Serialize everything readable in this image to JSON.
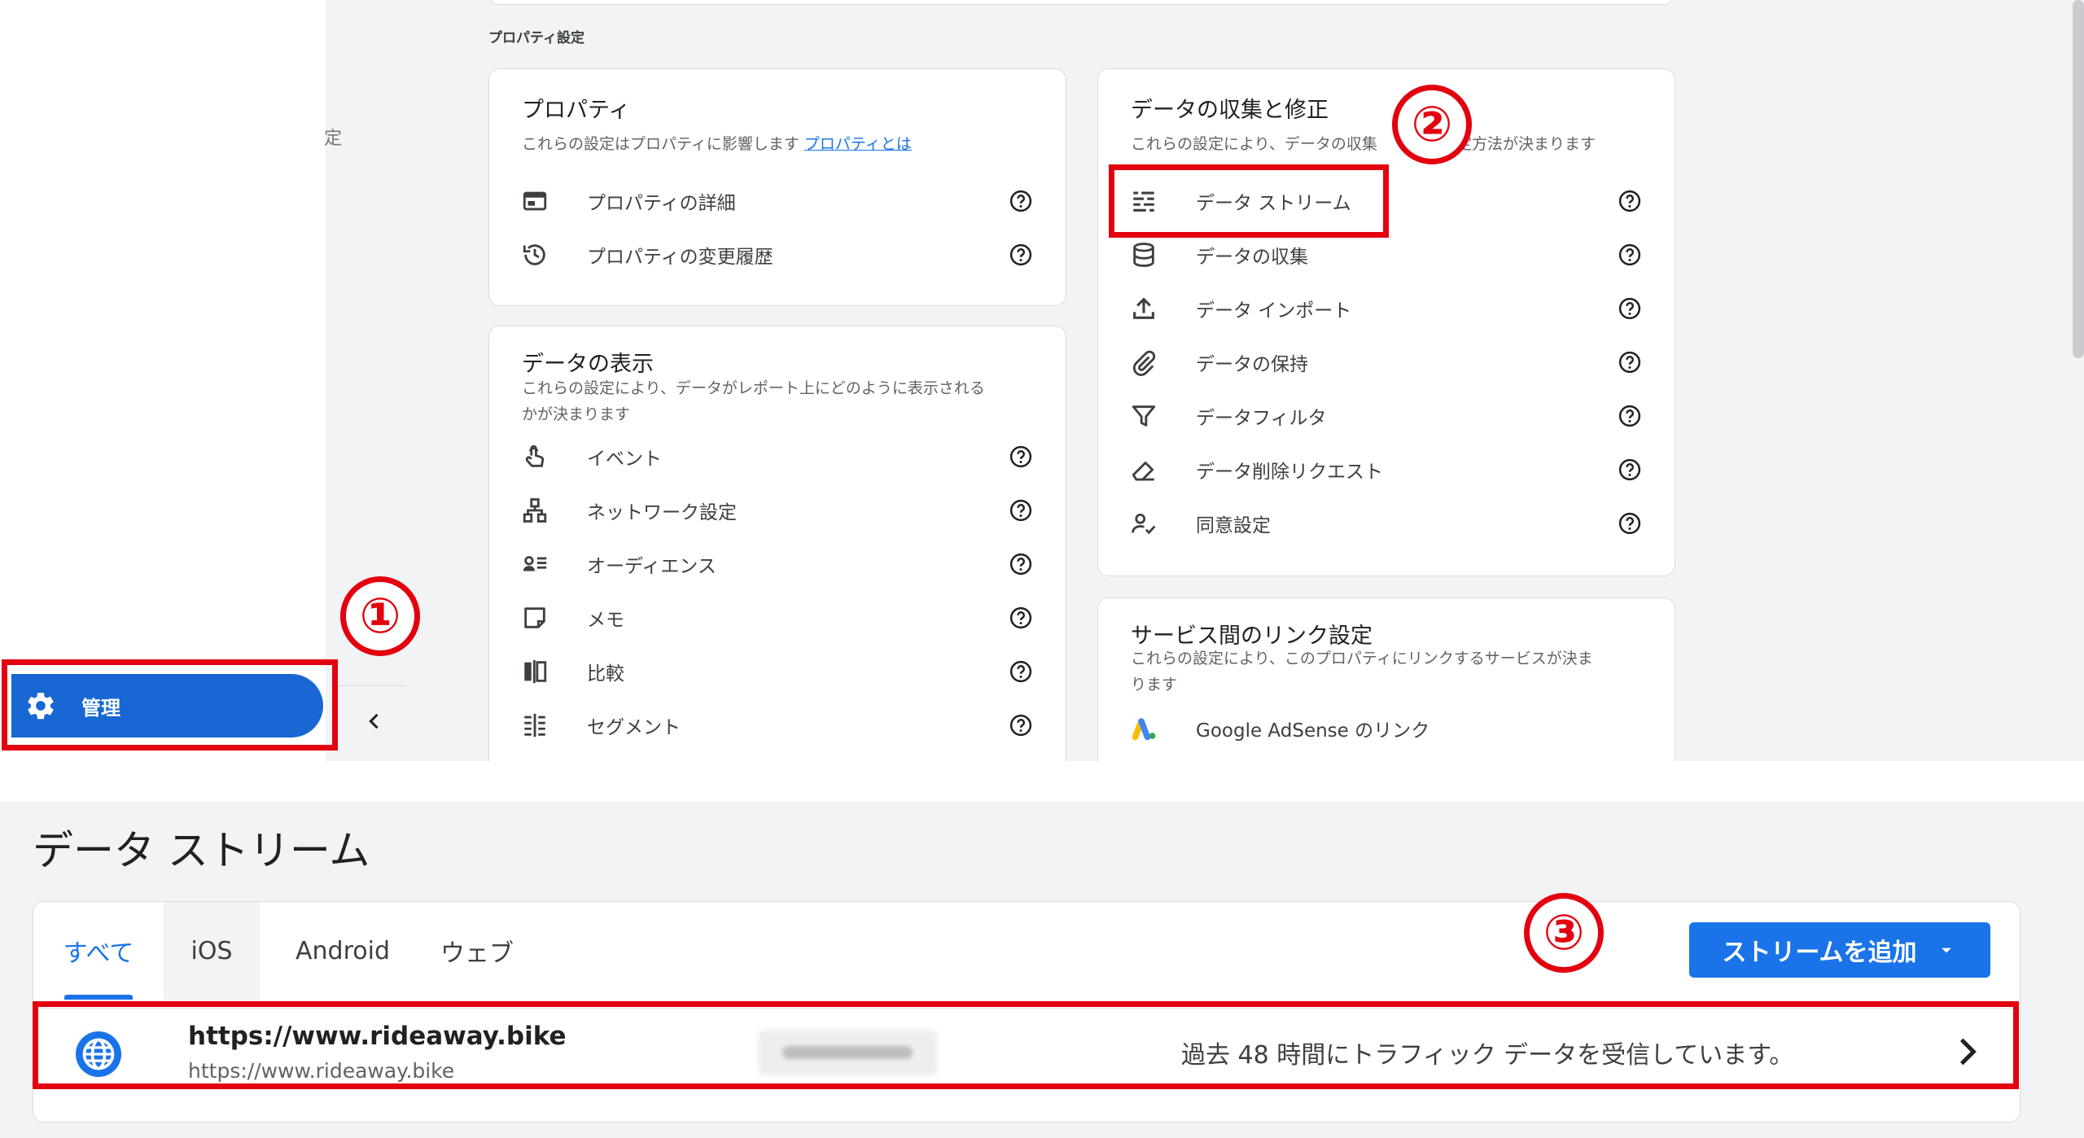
{
  "sidebar": {
    "edge_char": "定",
    "admin_label": "管理"
  },
  "section_heading": "プロパティ設定",
  "property_card": {
    "title": "プロパティ",
    "description": "これらの設定はプロパティに影響します",
    "link": "プロパティとは",
    "items": [
      {
        "label": "プロパティの詳細",
        "icon": "property-details-icon"
      },
      {
        "label": "プロパティの変更履歴",
        "icon": "history-icon"
      }
    ]
  },
  "display_card": {
    "title": "データの表示",
    "description_line1": "これらの設定により、データがレポート上にどのように表示される",
    "description_line2": "かが決まります",
    "items": [
      {
        "label": "イベント",
        "icon": "touch-icon"
      },
      {
        "label": "ネットワーク設定",
        "icon": "network-icon"
      },
      {
        "label": "オーディエンス",
        "icon": "audience-icon"
      },
      {
        "label": "メモ",
        "icon": "note-icon"
      },
      {
        "label": "比較",
        "icon": "compare-icon"
      },
      {
        "label": "セグメント",
        "icon": "segment-icon"
      }
    ]
  },
  "collection_card": {
    "title": "データの収集と修正",
    "description": "これらの設定により、データの収集",
    "description_tail": "定方法が決まります",
    "items": [
      {
        "label": "データ ストリーム",
        "icon": "data-stream-icon"
      },
      {
        "label": "データの収集",
        "icon": "database-icon"
      },
      {
        "label": "データ インポート",
        "icon": "upload-icon"
      },
      {
        "label": "データの保持",
        "icon": "attach-icon"
      },
      {
        "label": "データフィルタ",
        "icon": "filter-icon"
      },
      {
        "label": "データ削除リクエスト",
        "icon": "eraser-icon"
      },
      {
        "label": "同意設定",
        "icon": "consent-icon"
      }
    ]
  },
  "links_card": {
    "title": "サービス間のリンク設定",
    "description_line1": "これらの設定により、このプロパティにリンクするサービスが決ま",
    "description_line2": "ります",
    "items": [
      {
        "label": "Google AdSense のリンク",
        "icon": "adsense-icon"
      }
    ]
  },
  "annotations": {
    "one": "①",
    "two": "②",
    "three": "③",
    "color": "#e3000f"
  },
  "data_streams": {
    "title": "データ ストリーム",
    "tabs": [
      "すべて",
      "iOS",
      "Android",
      "ウェブ"
    ],
    "add_button": "ストリームを追加",
    "stream": {
      "name": "https://www.rideaway.bike",
      "url": "https://www.rideaway.bike",
      "status": "過去 48 時間にトラフィック データを受信しています。"
    }
  },
  "colors": {
    "accent": "#1a73e8",
    "admin_active": "#1967d2",
    "page_bg": "#f1f3f4"
  }
}
